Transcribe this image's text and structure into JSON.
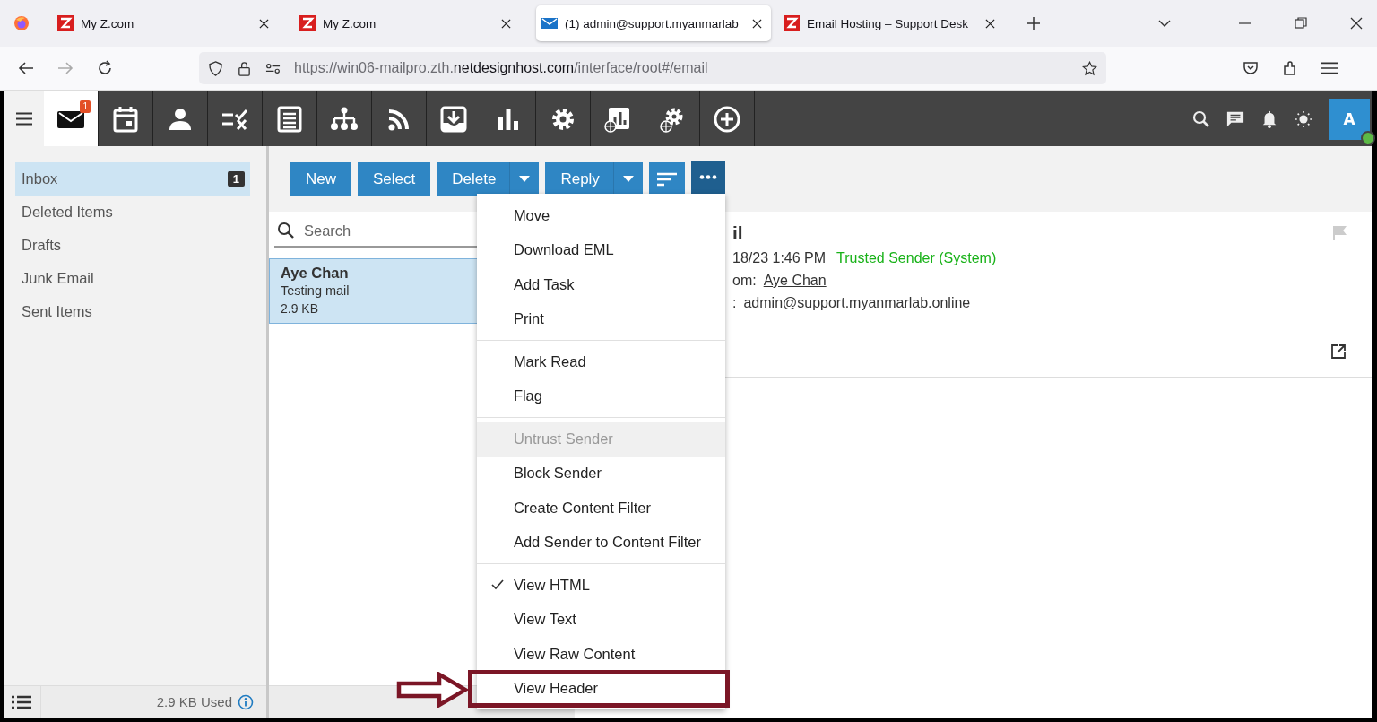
{
  "browser": {
    "tabs": [
      {
        "title": "My Z.com",
        "kind": "site",
        "selected": false
      },
      {
        "title": "My Z.com",
        "kind": "site",
        "selected": false
      },
      {
        "title": "(1) admin@support.myanmarlab",
        "kind": "mail",
        "selected": true
      },
      {
        "title": "Email Hosting – Support Desk",
        "kind": "site",
        "selected": false
      }
    ],
    "url": [
      {
        "text": "https://win06-mailpro.zth.",
        "strong": false
      },
      {
        "text": "netdesignhost.com",
        "strong": true
      },
      {
        "text": "/interface/root#/email",
        "strong": false
      }
    ]
  },
  "app_nav": [
    {
      "kind": "mail",
      "selected": true,
      "badge": "1"
    },
    {
      "kind": "calendar",
      "selected": false
    },
    {
      "kind": "contacts",
      "selected": false
    },
    {
      "kind": "tasks",
      "selected": false
    },
    {
      "kind": "notes",
      "selected": false
    },
    {
      "kind": "org",
      "selected": false
    },
    {
      "kind": "rss",
      "selected": false
    },
    {
      "kind": "archive",
      "selected": false
    },
    {
      "kind": "stats",
      "selected": false
    },
    {
      "kind": "settings",
      "selected": false
    },
    {
      "kind": "domain-stats",
      "selected": false
    },
    {
      "kind": "domain-settings",
      "selected": false
    },
    {
      "kind": "add",
      "selected": false
    }
  ],
  "user": {
    "initial": "A",
    "online": true
  },
  "folders": [
    {
      "label": "Inbox",
      "count": "1",
      "selected": true
    },
    {
      "label": "Deleted Items",
      "selected": false
    },
    {
      "label": "Drafts",
      "selected": false
    },
    {
      "label": "Junk Email",
      "selected": false
    },
    {
      "label": "Sent Items",
      "selected": false
    }
  ],
  "storage": "2.9 KB Used",
  "toolbar": [
    {
      "kind": "text",
      "label": "New",
      "pressed": false
    },
    {
      "kind": "text",
      "label": "Select",
      "pressed": false
    },
    {
      "kind": "split",
      "label": "Delete",
      "pressed": false
    },
    {
      "kind": "split",
      "label": "Reply",
      "pressed": false
    },
    {
      "kind": "sort",
      "pressed": false
    },
    {
      "kind": "more",
      "pressed": true
    }
  ],
  "search": {
    "placeholder": "Search"
  },
  "messages": [
    {
      "sender": "Aye Chan",
      "subject": "Testing mail",
      "size": "2.9 KB",
      "selected": true
    }
  ],
  "menu": [
    [
      {
        "label": "Move",
        "disabled": false,
        "checked": false,
        "annotated": false
      },
      {
        "label": "Download EML",
        "disabled": false,
        "checked": false,
        "annotated": false
      },
      {
        "label": "Add Task",
        "disabled": false,
        "checked": false,
        "annotated": false
      },
      {
        "label": "Print",
        "disabled": false,
        "checked": false,
        "annotated": false
      }
    ],
    [
      {
        "label": "Mark Read",
        "disabled": false,
        "checked": false,
        "annotated": false
      },
      {
        "label": "Flag",
        "disabled": false,
        "checked": false,
        "annotated": false
      }
    ],
    [
      {
        "label": "Untrust Sender",
        "disabled": true,
        "checked": false,
        "annotated": false
      },
      {
        "label": "Block Sender",
        "disabled": false,
        "checked": false,
        "annotated": false
      },
      {
        "label": "Create Content Filter",
        "disabled": false,
        "checked": false,
        "annotated": false
      },
      {
        "label": "Add Sender to Content Filter",
        "disabled": false,
        "checked": false,
        "annotated": false
      }
    ],
    [
      {
        "label": "View HTML",
        "disabled": false,
        "checked": true,
        "annotated": false
      },
      {
        "label": "View Text",
        "disabled": false,
        "checked": false,
        "annotated": false
      },
      {
        "label": "View Raw Content",
        "disabled": false,
        "checked": false,
        "annotated": false
      },
      {
        "label": "View Header",
        "disabled": false,
        "checked": false,
        "annotated": true
      }
    ]
  ],
  "reading": {
    "subject": "il",
    "date": "18/23 1:46 PM",
    "trust": "Trusted Sender (System)",
    "from_label": "om:",
    "from": "Aye Chan",
    "to_label": ":",
    "to": "admin@support.myanmarlab.online",
    "flagged": false
  }
}
